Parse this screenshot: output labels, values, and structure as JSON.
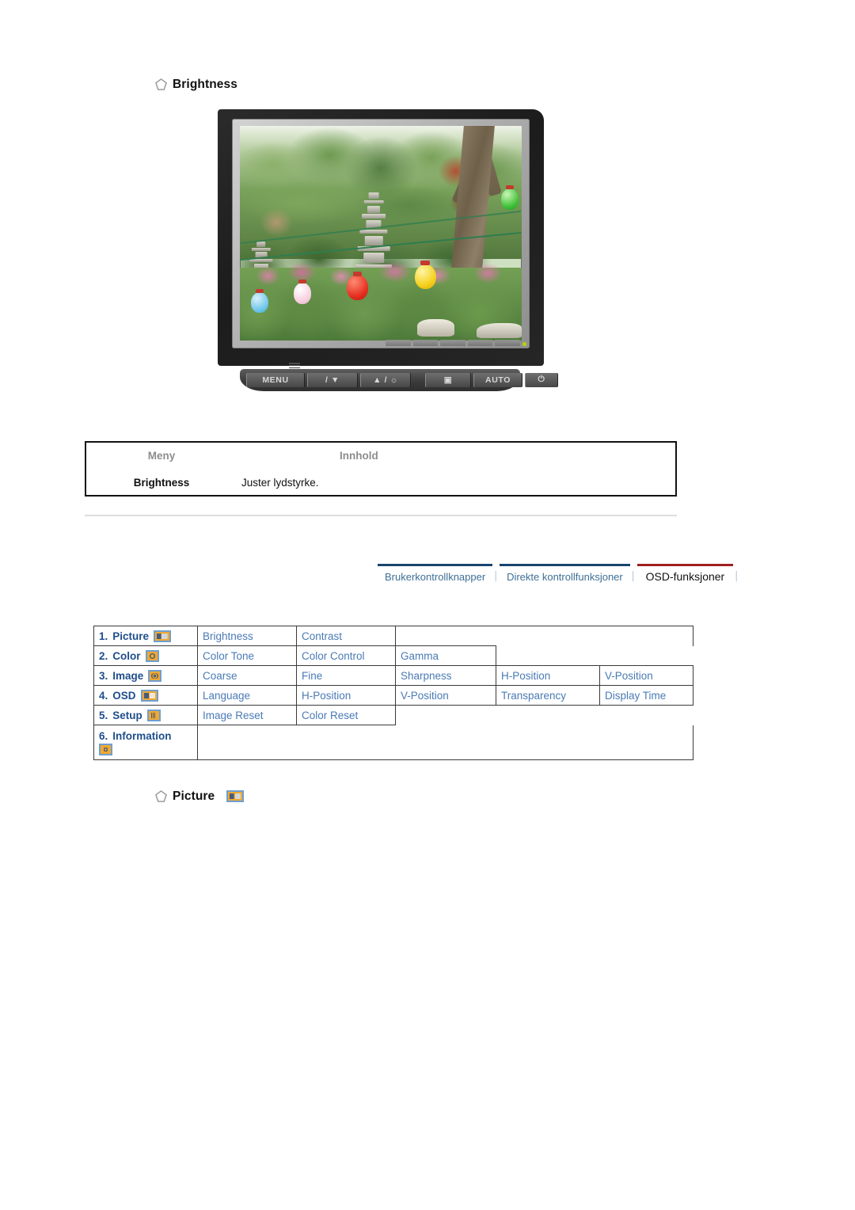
{
  "page": {
    "language": "no",
    "background": "#ffffff"
  },
  "sections": {
    "brightness_heading": "Brightness",
    "picture_heading": "Picture"
  },
  "monitor": {
    "alt": "Samsung LCD monitor showing a garden photo with a stone pagoda and paper lanterns",
    "control_buttons": [
      {
        "name": "menu-button",
        "label": "MENU"
      },
      {
        "name": "down-brightness-button",
        "label": "/ ▼"
      },
      {
        "name": "up-brightness-button",
        "label": "▲ / ☼"
      },
      {
        "name": "enter-source-button",
        "label": "▣"
      },
      {
        "name": "auto-button",
        "label": "AUTO"
      },
      {
        "name": "power-button",
        "label": "⏻"
      }
    ]
  },
  "info_table": {
    "headers": {
      "menu": "Meny",
      "content": "Innhold"
    },
    "rows": [
      {
        "menu": "Brightness",
        "content": "Juster lydstyrke."
      }
    ]
  },
  "nav_tabs": {
    "separator": "│",
    "items": [
      {
        "label": "Brukerkontrollknapper",
        "active": false
      },
      {
        "label": "Direkte kontrollfunksjoner",
        "active": false
      },
      {
        "label": "OSD-funksjoner",
        "active": true
      }
    ]
  },
  "osd_table": {
    "categories": [
      {
        "num": "1.",
        "label": "Picture",
        "icon": "picture-icon",
        "items": [
          "Brightness",
          "Contrast"
        ]
      },
      {
        "num": "2.",
        "label": "Color",
        "icon": "color-icon",
        "items": [
          "Color Tone",
          "Color Control",
          "Gamma"
        ]
      },
      {
        "num": "3.",
        "label": "Image",
        "icon": "image-icon",
        "items": [
          "Coarse",
          "Fine",
          "Sharpness",
          "H-Position",
          "V-Position"
        ]
      },
      {
        "num": "4.",
        "label": "OSD",
        "icon": "osd-icon",
        "items": [
          "Language",
          "H-Position",
          "V-Position",
          "Transparency",
          "Display Time"
        ]
      },
      {
        "num": "5.",
        "label": "Setup",
        "icon": "setup-icon",
        "items": [
          "Image Reset",
          "Color Reset"
        ]
      },
      {
        "num": "6.",
        "label": "Information",
        "icon": "info-icon",
        "items": []
      }
    ]
  },
  "colors": {
    "link_blue": "#4a7ab5",
    "category_blue": "#1f4e8c",
    "icon_orange": "#f0a830",
    "icon_border_blue": "#6f9fd0",
    "active_tab_rule": "#a01f1f",
    "inactive_tab_rule": "#18456e",
    "divider_gray": "#dddddd",
    "header_gray": "#8d8d8d"
  }
}
